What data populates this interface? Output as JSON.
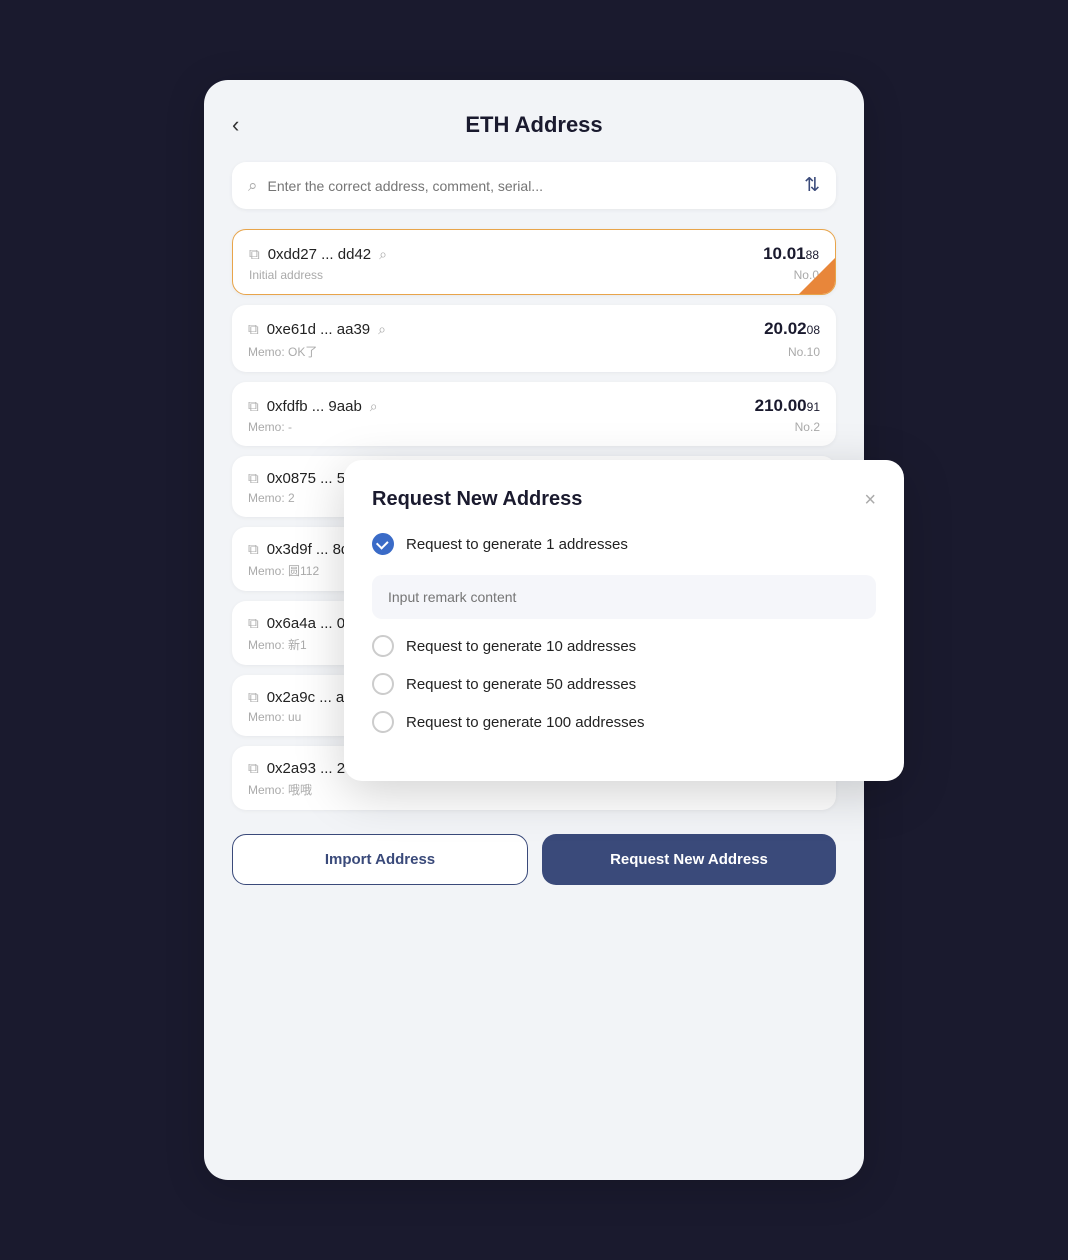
{
  "header": {
    "title": "ETH Address",
    "back_label": "‹"
  },
  "search": {
    "placeholder": "Enter the correct address, comment, serial..."
  },
  "addresses": [
    {
      "address": "0xdd27 ... dd42",
      "memo": "Initial address",
      "amount_main": "10.01",
      "amount_decimal": "88",
      "badge": "No.0",
      "active": true
    },
    {
      "address": "0xe61d ... aa39",
      "memo": "Memo: OK了",
      "amount_main": "20.02",
      "amount_decimal": "08",
      "badge": "No.10",
      "active": false
    },
    {
      "address": "0xfdfb ... 9aab",
      "memo": "Memo: -",
      "amount_main": "210.00",
      "amount_decimal": "91",
      "badge": "No.2",
      "active": false
    },
    {
      "address": "0x0875 ... 5247",
      "memo": "Memo: 2",
      "amount_main": "",
      "amount_decimal": "",
      "badge": "",
      "active": false
    },
    {
      "address": "0x3d9f ... 8d06",
      "memo": "Memo: 圆112",
      "amount_main": "",
      "amount_decimal": "",
      "badge": "",
      "active": false
    },
    {
      "address": "0x6a4a ... 0be3",
      "memo": "Memo: 新1",
      "amount_main": "",
      "amount_decimal": "",
      "badge": "",
      "active": false
    },
    {
      "address": "0x2a9c ... a904",
      "memo": "Memo: uu",
      "amount_main": "",
      "amount_decimal": "",
      "badge": "",
      "active": false
    },
    {
      "address": "0x2a93 ... 2006",
      "memo": "Memo: 哦哦",
      "amount_main": "",
      "amount_decimal": "",
      "badge": "",
      "active": false
    }
  ],
  "footer": {
    "import_label": "Import Address",
    "request_label": "Request New Address"
  },
  "modal": {
    "title": "Request New Address",
    "close_label": "×",
    "remark_placeholder": "Input remark content",
    "options": [
      {
        "label": "Request to generate 1 addresses",
        "checked": true
      },
      {
        "label": "Request to generate 10 addresses",
        "checked": false
      },
      {
        "label": "Request to generate 50 addresses",
        "checked": false
      },
      {
        "label": "Request to generate 100 addresses",
        "checked": false
      }
    ]
  }
}
